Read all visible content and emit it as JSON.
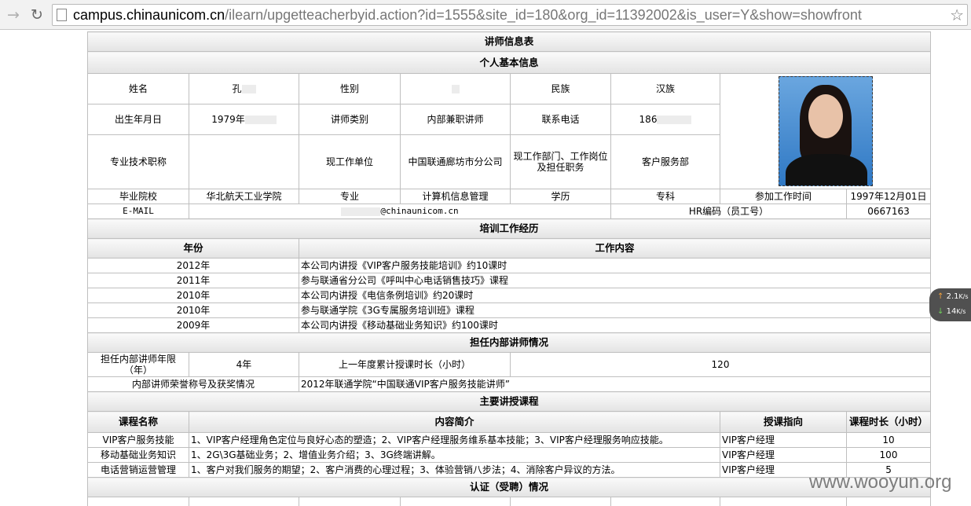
{
  "browser": {
    "url_host": "campus.chinaunicom.cn",
    "url_path": "/ilearn/upgetteacherbyid.action?id=1555&site_id=180&org_id=11392002&is_user=Y&show=showfront"
  },
  "form": {
    "title": "讲师信息表",
    "basic_section": "个人基本信息",
    "labels": {
      "name": "姓名",
      "gender": "性别",
      "ethnicity": "民族",
      "birth": "出生年月日",
      "teacher_type": "讲师类别",
      "phone": "联系电话",
      "title": "专业技术职称",
      "unit": "现工作单位",
      "dept": "现工作部门、工作岗位及担任职务",
      "school": "毕业院校",
      "major": "专业",
      "degree": "学历",
      "work_start": "参加工作时间",
      "email": "E-MAIL",
      "hr_code": "HR编码（员工号）"
    },
    "values": {
      "name": "孔",
      "ethnicity": "汉族",
      "birth": "1979年",
      "teacher_type": "内部兼职讲师",
      "phone": "186",
      "unit": "中国联通廊坊市分公司",
      "dept": "客户服务部",
      "school": "华北航天工业学院",
      "major": "计算机信息管理",
      "degree": "专科",
      "work_start": "1997年12月01日",
      "email": "@chinaunicom.cn",
      "hr_code": "0667163"
    },
    "training_section": "培训工作经历",
    "training_headers": {
      "year": "年份",
      "content": "工作内容"
    },
    "training": [
      {
        "year": "2012年",
        "content": "本公司内讲授《VIP客户服务技能培训》约10课时"
      },
      {
        "year": "2011年",
        "content": "参与联通省分公司《呼叫中心电话销售技巧》课程"
      },
      {
        "year": "2010年",
        "content": "本公司内讲授《电信条例培训》约20课时"
      },
      {
        "year": "2010年",
        "content": "参与联通学院《3G专属服务培训班》课程"
      },
      {
        "year": "2009年",
        "content": "本公司内讲授《移动基础业务知识》约100课时"
      }
    ],
    "lecturer_section": "担任内部讲师情况",
    "lecturer": {
      "years_label": "担任内部讲师年限（年）",
      "years_value": "4年",
      "hours_label": "上一年度累计授课时长（小时）",
      "hours_value": "120",
      "honor_label": "内部讲师荣誉称号及获奖情况",
      "honor_value": "2012年联通学院“中国联通VIP客户服务技能讲师”"
    },
    "courses_section": "主要讲授课程",
    "course_headers": {
      "name": "课程名称",
      "intro": "内容简介",
      "target": "授课指向",
      "hours": "课程时长（小时）"
    },
    "courses": [
      {
        "name": "VIP客户服务技能",
        "intro": "1、VIP客户经理角色定位与良好心态的塑造；2、VIP客户经理服务维系基本技能；3、VIP客户经理服务响应技能。",
        "target": "VIP客户经理",
        "hours": "10"
      },
      {
        "name": "移动基础业务知识",
        "intro": "1、2G\\3G基础业务；2、增值业务介绍；3、3G终端讲解。",
        "target": "VIP客户经理",
        "hours": "100"
      },
      {
        "name": "电话营销运营管理",
        "intro": "1、客户对我们服务的期望；2、客户消费的心理过程；3、体验营销八步法；4、消除客户异议的方法。",
        "target": "VIP客户经理",
        "hours": "5"
      }
    ],
    "cert_section": "认证（受聘）情况"
  },
  "speed": {
    "up": "2.1",
    "up_unit": "K/s",
    "down": "14",
    "down_unit": "K/s"
  },
  "watermark": "www.wooyun.org"
}
